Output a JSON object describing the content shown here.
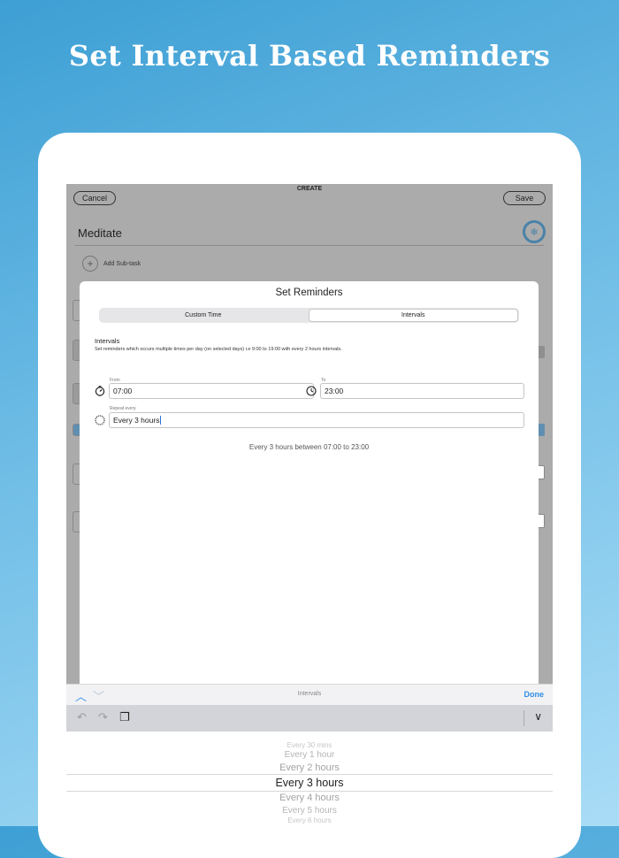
{
  "headline": "Set Interval Based Reminders",
  "create_screen": {
    "title": "CREATE",
    "cancel_label": "Cancel",
    "save_label": "Save",
    "task_name": "Meditate",
    "add_subtask_label": "Add Sub-task"
  },
  "modal": {
    "title": "Set Reminders",
    "tabs": [
      {
        "label": "Custom Time",
        "active": false
      },
      {
        "label": "Intervals",
        "active": true
      }
    ],
    "section_title": "Intervals",
    "section_desc": "Set reminders which occurs multiple times per day (on selected days) i.e 9:00 to 19:00 with every 2 hours intervals.",
    "from_label": "From",
    "from_value": "07:00",
    "to_label": "To",
    "to_value": "23:00",
    "repeat_label": "Repeat every",
    "repeat_value": "Every 3 hours",
    "summary": "Every 3 hours between 07:00 to 23:00"
  },
  "accessory": {
    "title": "Intervals",
    "done_label": "Done"
  },
  "picker": {
    "options": [
      "Every 30 mins",
      "Every 1 hour",
      "Every 2 hours",
      "Every 3 hours",
      "Every 4 hours",
      "Every 5 hours",
      "Every 6 hours"
    ],
    "selected": "Every 3 hours"
  },
  "colors": {
    "accent": "#2f8de4",
    "caret": "#2a6fd6",
    "background_top": "#3d9fd4",
    "background_bottom": "#a9dcf6"
  }
}
